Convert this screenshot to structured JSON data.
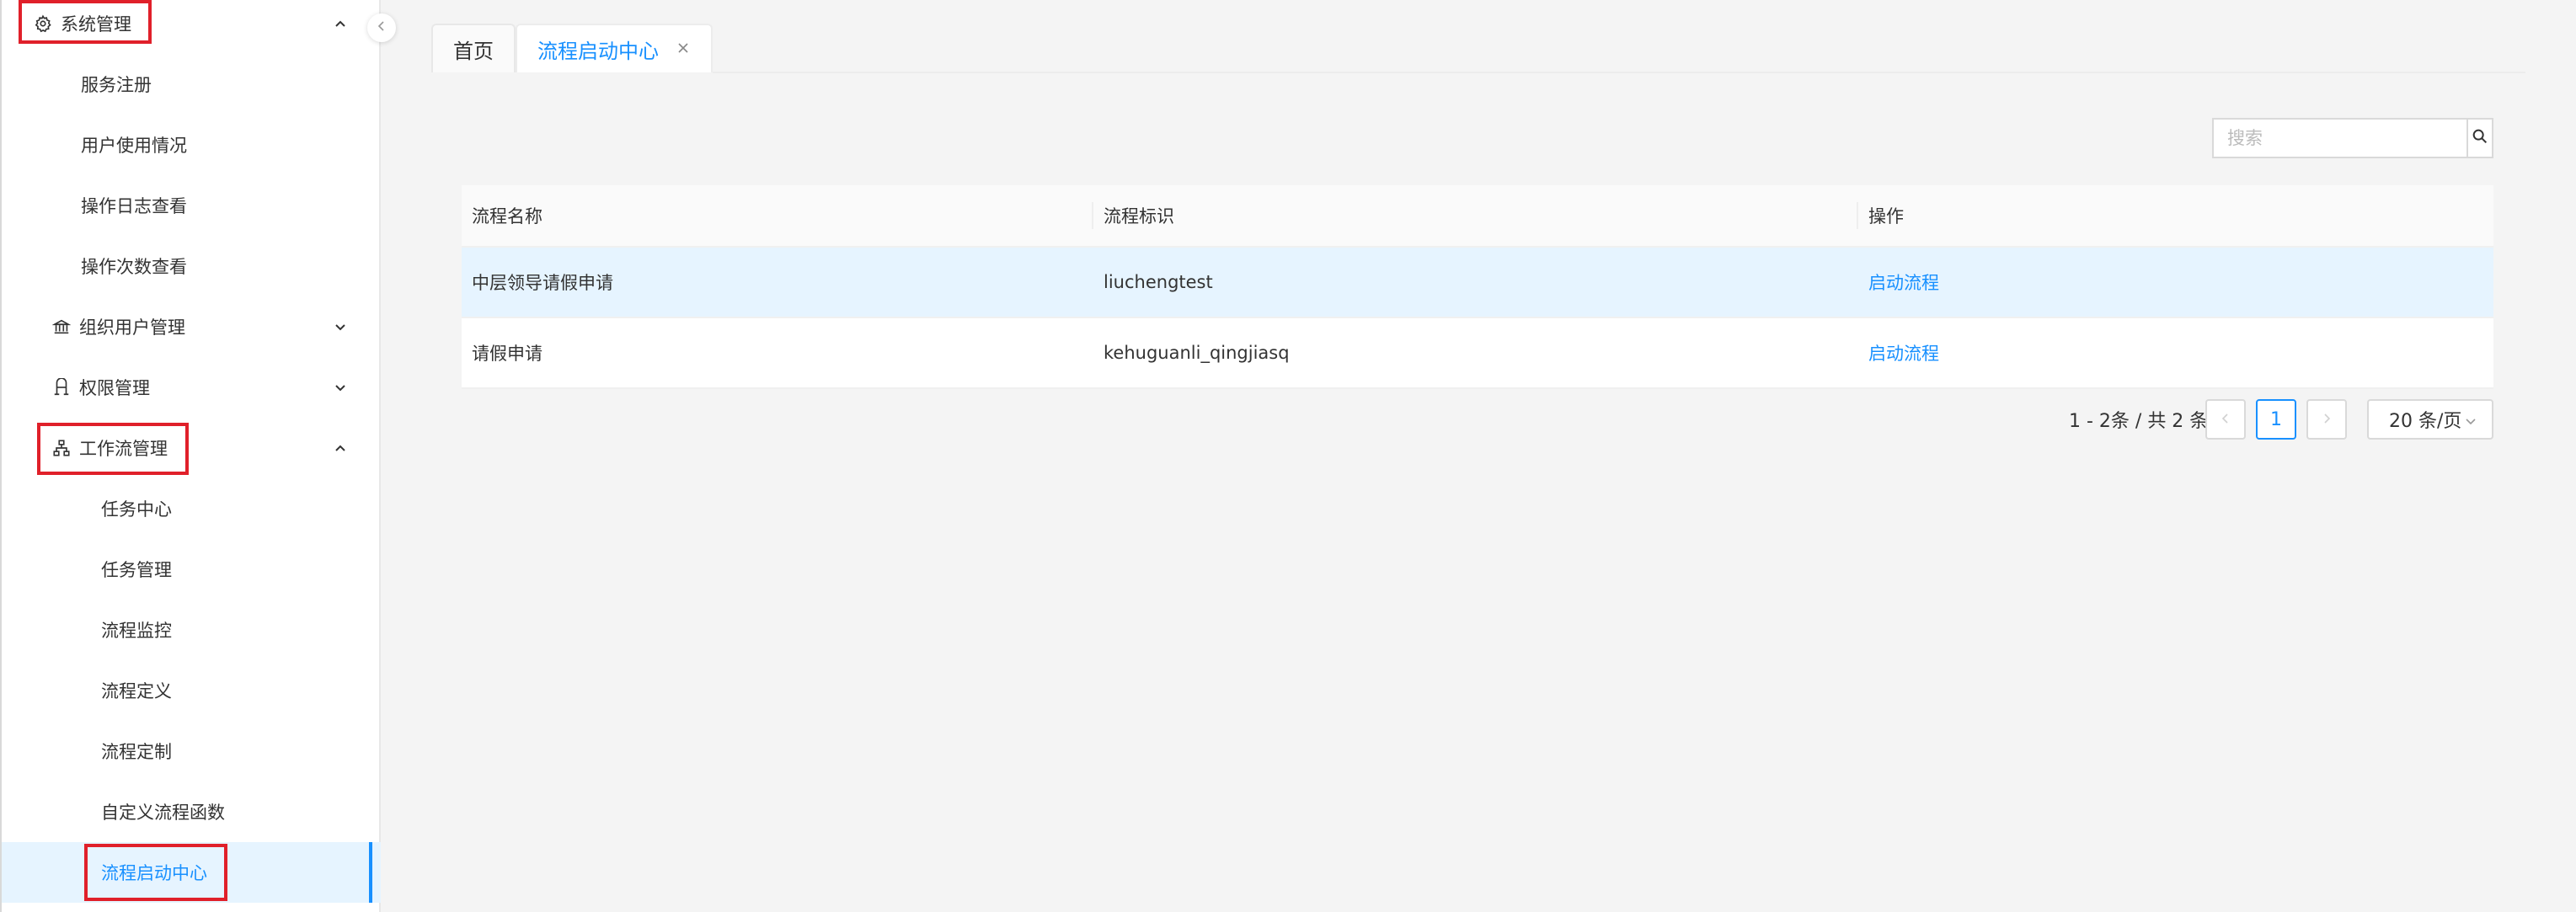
{
  "sidebar": {
    "items": [
      {
        "label": "系统管理",
        "icon": "gear-icon",
        "arrow": "chevron-up"
      },
      {
        "label": "服务注册"
      },
      {
        "label": "用户使用情况"
      },
      {
        "label": "操作日志查看"
      },
      {
        "label": "操作次数查看"
      },
      {
        "label": "组织用户管理",
        "icon": "bank-icon",
        "arrow": "chevron-down"
      },
      {
        "label": "权限管理",
        "icon": "key-icon",
        "arrow": "chevron-down"
      },
      {
        "label": "工作流管理",
        "icon": "workflow-icon",
        "arrow": "chevron-up"
      },
      {
        "label": "任务中心"
      },
      {
        "label": "任务管理"
      },
      {
        "label": "流程监控"
      },
      {
        "label": "流程定义"
      },
      {
        "label": "流程定制"
      },
      {
        "label": "自定义流程函数"
      },
      {
        "label": "流程启动中心",
        "active": true
      }
    ]
  },
  "tabs": [
    {
      "label": "首页"
    },
    {
      "label": "流程启动中心",
      "active": true
    }
  ],
  "search": {
    "placeholder": "搜索",
    "value": ""
  },
  "table": {
    "columns": [
      "流程名称",
      "流程标识",
      "操作"
    ],
    "rows": [
      {
        "name": "中层领导请假申请",
        "key": "liuchengtest",
        "action": "启动流程"
      },
      {
        "name": "请假申请",
        "key": "kehuguanli_qingjiasq",
        "action": "启动流程"
      }
    ]
  },
  "pagination": {
    "total_text": "1 - 2条 / 共 2 条",
    "current_page": "1",
    "page_size": "20 条/页"
  },
  "colors": {
    "accent": "#1890ff",
    "highlight": "#e6f4ff",
    "annotation": "#e0202a"
  }
}
